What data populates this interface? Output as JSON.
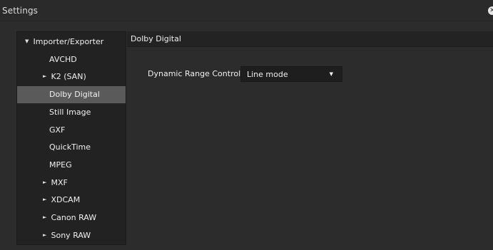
{
  "window": {
    "title": "Settings",
    "close_glyph": "✕"
  },
  "nav": {
    "items": [
      {
        "label": "Importer/Exporter",
        "indent": 0,
        "arrow": "▼",
        "selected": false
      },
      {
        "label": "AVCHD",
        "indent": 1,
        "arrow": "",
        "selected": false
      },
      {
        "label": "K2 (SAN)",
        "indent": 1,
        "arrow": "►",
        "selected": false
      },
      {
        "label": "Dolby Digital",
        "indent": 1,
        "arrow": "",
        "selected": true
      },
      {
        "label": "Still Image",
        "indent": 1,
        "arrow": "",
        "selected": false
      },
      {
        "label": "GXF",
        "indent": 1,
        "arrow": "",
        "selected": false
      },
      {
        "label": "QuickTime",
        "indent": 1,
        "arrow": "",
        "selected": false
      },
      {
        "label": "MPEG",
        "indent": 1,
        "arrow": "",
        "selected": false
      },
      {
        "label": "MXF",
        "indent": 1,
        "arrow": "►",
        "selected": false
      },
      {
        "label": "XDCAM",
        "indent": 1,
        "arrow": "►",
        "selected": false
      },
      {
        "label": "Canon RAW",
        "indent": 1,
        "arrow": "►",
        "selected": false
      },
      {
        "label": "Sony RAW",
        "indent": 1,
        "arrow": "►",
        "selected": false
      }
    ]
  },
  "content": {
    "section_title": "Dolby Digital",
    "drc_label": "Dynamic Range Control",
    "drc_value": "Line mode",
    "dropdown_glyph": "▼"
  },
  "colors": {
    "background": "#2b2b2b",
    "panel": "#222222",
    "selected": "#5a5a5a",
    "text": "#f0f0f0"
  }
}
